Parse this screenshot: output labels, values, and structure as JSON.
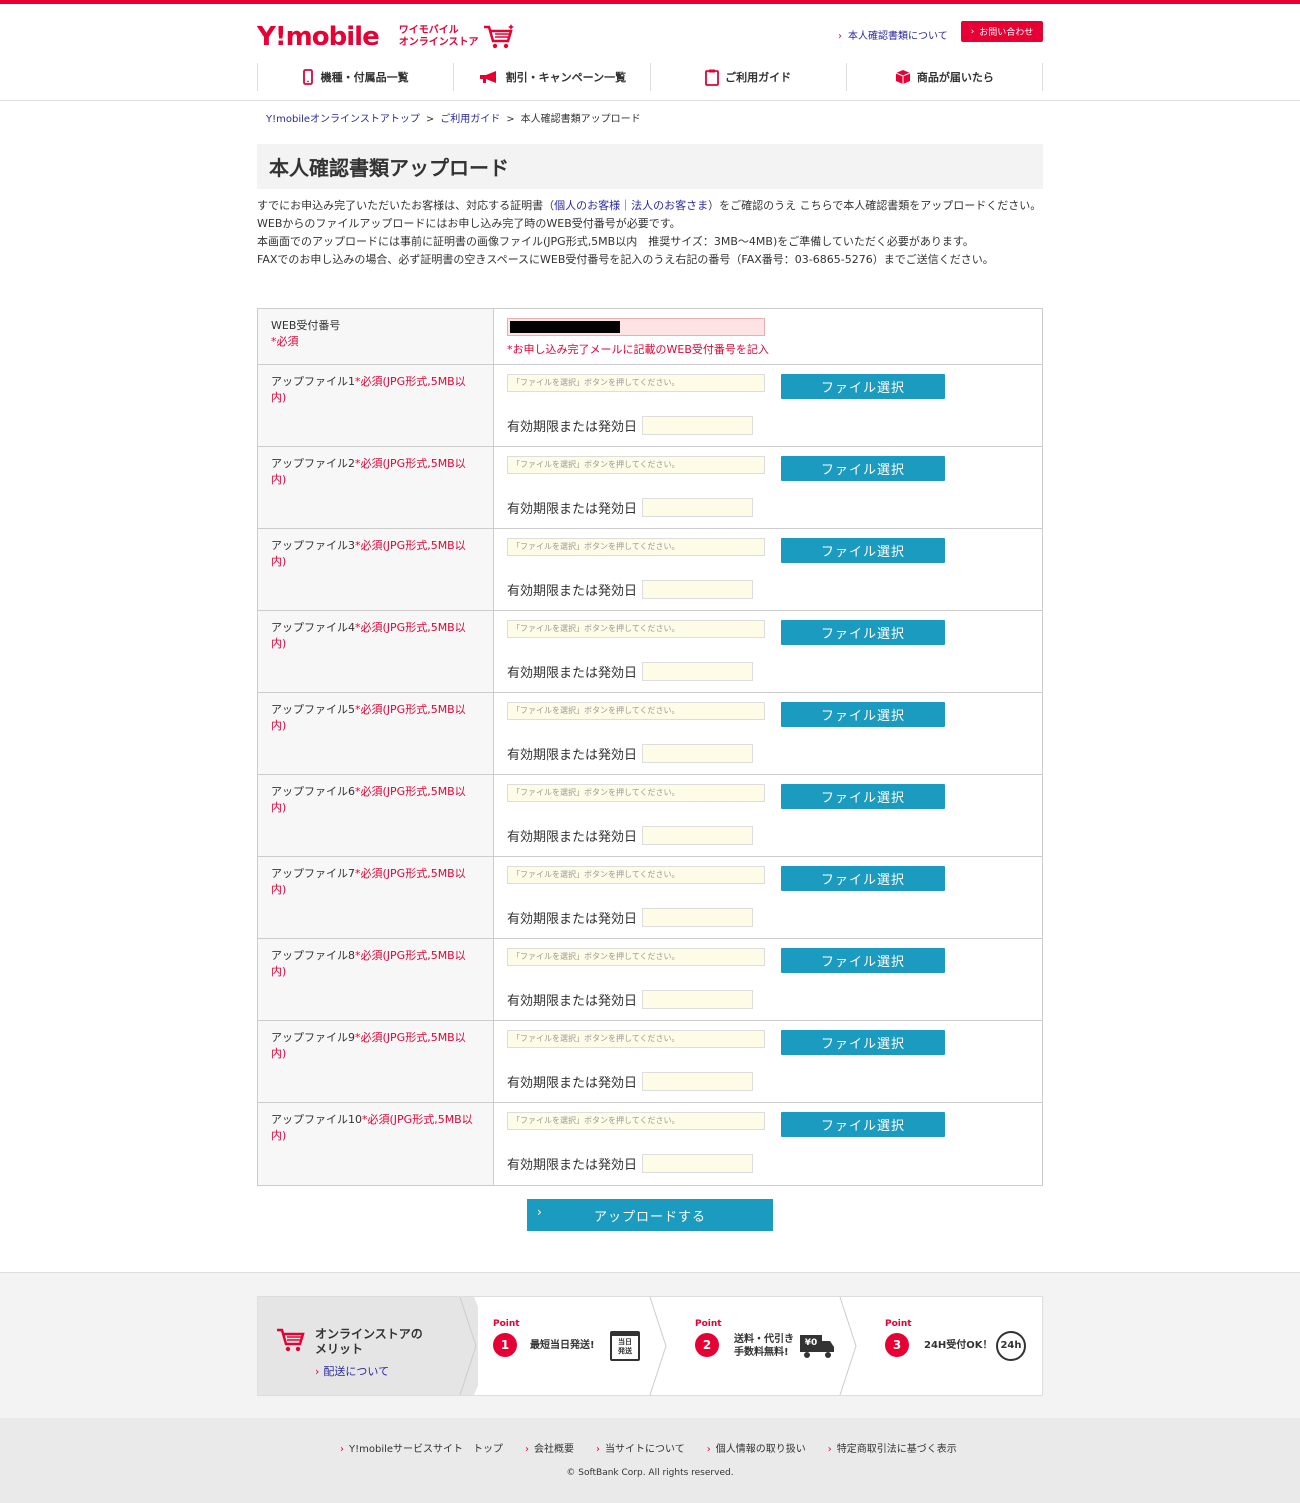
{
  "header": {
    "logo_brand": "Y!mobile",
    "logo_sub_line1": "ワイモバイル",
    "logo_sub_line2": "オンラインストア",
    "doc_link": "本人確認書類について",
    "contact_button": "お問い合わせ",
    "nav": [
      {
        "label": "機種・付属品一覧",
        "icon": "phone-icon"
      },
      {
        "label": "割引・キャンペーン一覧",
        "icon": "megaphone-icon"
      },
      {
        "label": "ご利用ガイド",
        "icon": "clipboard-icon"
      },
      {
        "label": "商品が届いたら",
        "icon": "box-icon"
      }
    ]
  },
  "breadcrumb": {
    "items": [
      "Y!mobileオンラインストアトップ",
      "ご利用ガイド",
      "本人確認書類アップロード"
    ],
    "separator": ">"
  },
  "page": {
    "title": "本人確認書類アップロード",
    "intro_line1_pre": "すでにお申込み完了いただいたお客様は、対応する証明書（",
    "intro_link_personal": "個人のお客様",
    "intro_link_sep": "｜",
    "intro_link_corporate": "法人のお客さま",
    "intro_line1_post": "）をご確認のうえ こちらで本人確認書類をアップロードください。",
    "intro_line2": "WEBからのファイルアップロードにはお申し込み完了時のWEB受付番号が必要です。",
    "intro_line3": "本画面でのアップロードには事前に証明書の画像ファイル(JPG形式,5MB以内　推奨サイズ：3MB〜4MB)をご準備していただく必要があります。",
    "intro_line4": "FAXでのお申し込みの場合、必ず証明書の空きスペースにWEB受付番号を記入のうえ右記の番号（FAX番号：03-6865-5276）までご送信ください。"
  },
  "form": {
    "web_label": "WEB受付番号",
    "web_required": "*必須",
    "web_note": "*お申し込み完了メールに記載のWEB受付番号を記入",
    "file_placeholder": "「ファイルを選択」ボタンを押してください。",
    "file_button": "ファイル選択",
    "expiry_label": "有効期限または発効日",
    "files": [
      {
        "label": "アップファイル1",
        "req": "*必須(JPG形式,5MB以内)"
      },
      {
        "label": "アップファイル2",
        "req": "*必須(JPG形式,5MB以内)"
      },
      {
        "label": "アップファイル3",
        "req": "*必須(JPG形式,5MB以内)"
      },
      {
        "label": "アップファイル4",
        "req": "*必須(JPG形式,5MB以内)"
      },
      {
        "label": "アップファイル5",
        "req": "*必須(JPG形式,5MB以内)"
      },
      {
        "label": "アップファイル6",
        "req": "*必須(JPG形式,5MB以内)"
      },
      {
        "label": "アップファイル7",
        "req": "*必須(JPG形式,5MB以内)"
      },
      {
        "label": "アップファイル8",
        "req": "*必須(JPG形式,5MB以内)"
      },
      {
        "label": "アップファイル9",
        "req": "*必須(JPG形式,5MB以内)"
      },
      {
        "label": "アップファイル10",
        "req": "*必須(JPG形式,5MB以内)"
      }
    ],
    "upload_button": "アップロードする"
  },
  "merit": {
    "title_line1": "オンラインストアの",
    "title_line2": "メリット",
    "link": "配送について",
    "points": [
      {
        "label": "Point",
        "num": "1",
        "text1": "最短当日発送!",
        "text2": "",
        "icon": "calendar-icon",
        "icon_text1": "当日",
        "icon_text2": "発送"
      },
      {
        "label": "Point",
        "num": "2",
        "text1": "送料・代引き",
        "text2": "手数料無料!",
        "icon": "truck-icon",
        "icon_text1": "¥0",
        "icon_text2": ""
      },
      {
        "label": "Point",
        "num": "3",
        "text1": "24H受付OK！",
        "text2": "",
        "icon": "clock-24h-icon",
        "icon_text1": "24h",
        "icon_text2": ""
      }
    ]
  },
  "footer": {
    "links": [
      "Y!mobileサービスサイト　トップ",
      "会社概要",
      "当サイトについて",
      "個人情報の取り扱い",
      "特定商取引法に基づく表示"
    ],
    "copyright": "© SoftBank Corp. All rights reserved."
  },
  "colors": {
    "brand_red": "#e60033",
    "button_teal": "#1a9bbf",
    "link_blue": "#2a2aa0"
  }
}
